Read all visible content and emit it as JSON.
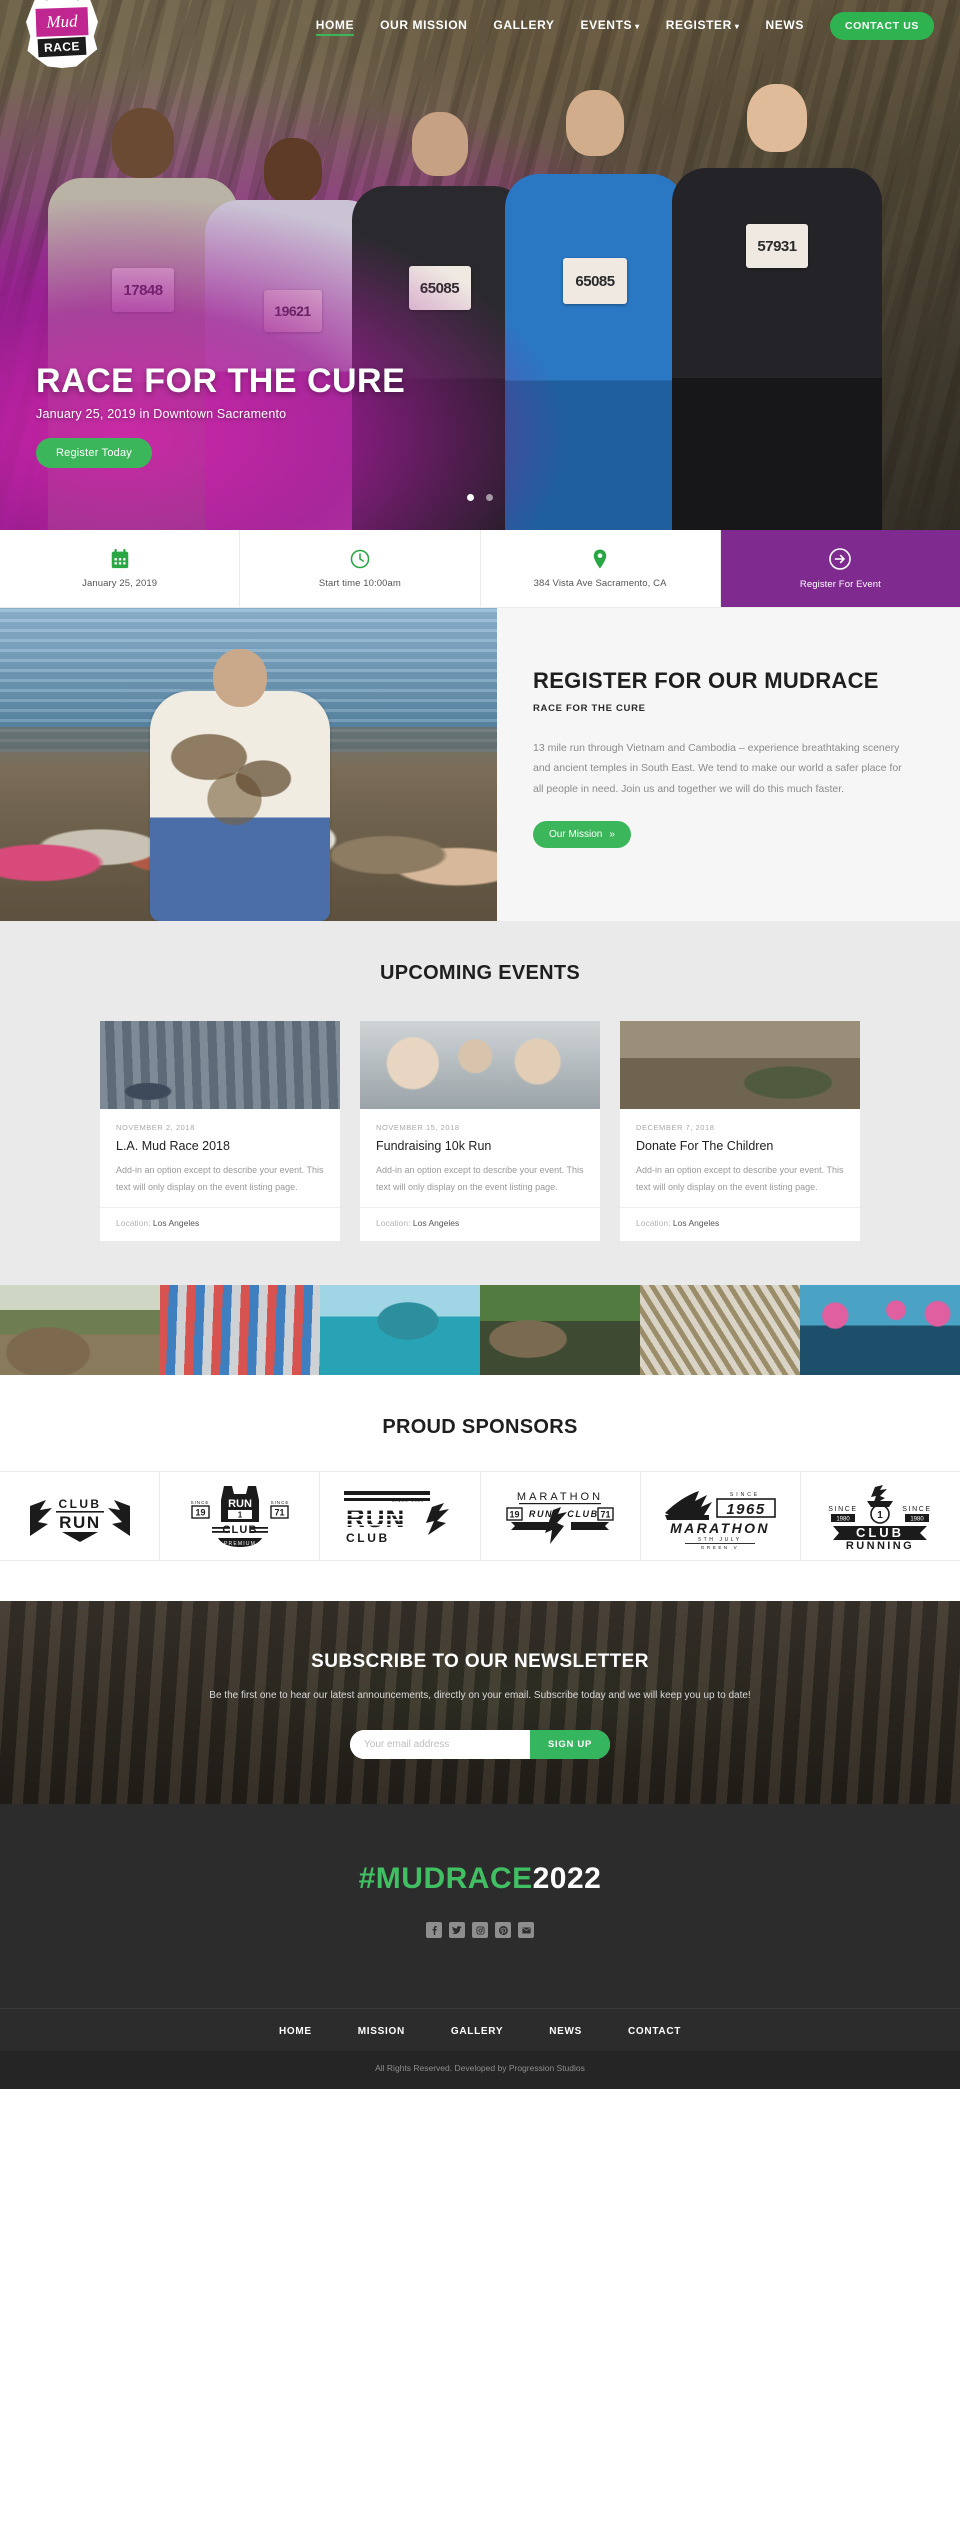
{
  "brand": {
    "logo_top": "Mud",
    "logo_bottom": "RACE"
  },
  "nav": {
    "items": [
      {
        "label": "HOME",
        "active": true,
        "caret": false
      },
      {
        "label": "OUR MISSION",
        "active": false,
        "caret": false
      },
      {
        "label": "GALLERY",
        "active": false,
        "caret": false
      },
      {
        "label": "EVENTS",
        "active": false,
        "caret": true
      },
      {
        "label": "REGISTER",
        "active": false,
        "caret": true
      },
      {
        "label": "NEWS",
        "active": false,
        "caret": false
      }
    ],
    "contact_label": "CONTACT US"
  },
  "hero": {
    "title": "RACE FOR THE CURE",
    "subtitle": "January 25, 2019 in Downtown Sacramento",
    "cta": "Register Today",
    "bibs": [
      "17848",
      "19621",
      "65085",
      "57931"
    ],
    "slides": 2,
    "active_slide": 1
  },
  "infobar": {
    "items": [
      {
        "icon": "calendar-icon",
        "label": "January 25, 2019"
      },
      {
        "icon": "clock-icon",
        "label": "Start time 10:00am"
      },
      {
        "icon": "map-pin-icon",
        "label": "384 Vista Ave Sacramento, CA"
      },
      {
        "icon": "arrow-circle-right-icon",
        "label": "Register For Event"
      }
    ],
    "accent": "#7e2a8f"
  },
  "about": {
    "title_highlight": "REGISTER",
    "title_rest": " FOR OUR MUDRACE",
    "kicker": "RACE FOR THE CURE",
    "body": "13 mile run through Vietnam and Cambodia – experience breathtaking scenery and ancient temples in South East. We tend to make our world a safer place for all people in need. Join us and together we will do this much faster.",
    "cta": "Our Mission",
    "cta_chevron": "»"
  },
  "events": {
    "title_highlight": "UPCOMING",
    "title_rest": " EVENTS",
    "location_label": "Location:",
    "cards": [
      {
        "date": "NOVEMBER 2, 2018",
        "title": "L.A. Mud Race 2018",
        "desc": "Add-in an option except to describe your event. This text will only display on the event listing page.",
        "location": "Los Angeles"
      },
      {
        "date": "NOVEMBER 15, 2018",
        "title": "Fundraising 10k Run",
        "desc": "Add-in an option except to describe your event. This text will only display on the event listing page.",
        "location": "Los Angeles"
      },
      {
        "date": "DECEMBER 7, 2018",
        "title": "Donate For The Children",
        "desc": "Add-in an option except to describe your event. This text will only display on the event listing page.",
        "location": "Los Angeles"
      }
    ]
  },
  "gallery": {
    "items": [
      "mud-pit-photo",
      "road-runners-photo",
      "water-slide-photo",
      "muddy-faces-photo",
      "rope-climb-photo",
      "open-water-swim-photo"
    ]
  },
  "sponsors": {
    "title_highlight": "PROUD",
    "title_rest": " SPONSORS",
    "logos": [
      {
        "name": "club-run-logo",
        "line1": "CLUB",
        "line2": "RUN"
      },
      {
        "name": "run-1-club-premium-logo",
        "line1": "RUN",
        "line2": "CLUB",
        "badge_left": "19",
        "badge_right": "71",
        "foot": "PREMIUM",
        "num": "1",
        "since": "SINCE"
      },
      {
        "name": "run-club-striped-logo",
        "line1": "RUN",
        "line2": "CLUB",
        "since": "SINCE 1989"
      },
      {
        "name": "marathon-run-club-logo",
        "line1": "MARATHON",
        "line2": "RUN",
        "line3": "CLUB",
        "badge_left": "19",
        "badge_right": "71"
      },
      {
        "name": "marathon-1965-logo",
        "since": "SINCE",
        "year": "1965",
        "line1": "MARATHON",
        "line2": "5TH JULY",
        "line3": "GREEN V"
      },
      {
        "name": "club-running-logo",
        "since": "SINCE",
        "year": "1980",
        "num": "1",
        "line1": "CLUB",
        "line2": "RUNNING"
      }
    ]
  },
  "newsletter": {
    "title": "SUBSCRIBE TO OUR NEWSLETTER",
    "subtitle": "Be the first one to hear our latest announcements, directly on your email. Subscribe today and we will keep you up to date!",
    "placeholder": "Your email address",
    "value": "",
    "button": "SIGN UP"
  },
  "footer": {
    "brand_green": "#MUDRACE",
    "brand_white": "2022",
    "socials": [
      "facebook-icon",
      "twitter-icon",
      "instagram-icon",
      "pinterest-icon",
      "email-icon"
    ],
    "nav": [
      "HOME",
      "MISSION",
      "GALLERY",
      "NEWS",
      "CONTACT"
    ],
    "copyright": "All Rights Reserved. Developed by Progression Studios"
  },
  "colors": {
    "green": "#3cb65a",
    "purple": "#7e2a8f",
    "magenta": "#c0268f",
    "dark": "#2c2c2c"
  }
}
